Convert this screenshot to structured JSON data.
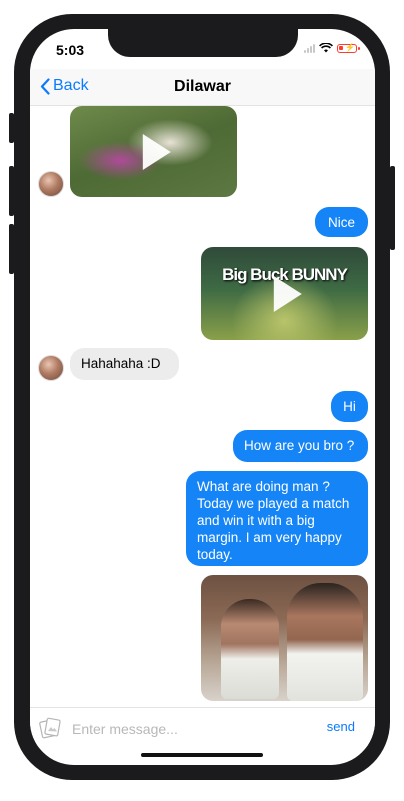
{
  "status_bar": {
    "time": "5:03"
  },
  "nav": {
    "back_label": "Back",
    "title": "Dilawar"
  },
  "messages": {
    "m1": {
      "type": "video",
      "direction": "incoming"
    },
    "m2": {
      "text": "Nice",
      "direction": "outgoing"
    },
    "m3": {
      "type": "video",
      "direction": "outgoing",
      "overlay_text": "Big Buck BUNNY"
    },
    "m4": {
      "text": "Hahahaha :D",
      "direction": "incoming"
    },
    "m5": {
      "text": "Hi",
      "direction": "outgoing"
    },
    "m6": {
      "text": "How are you bro ?",
      "direction": "outgoing"
    },
    "m7": {
      "text": "What are doing man ? Today we played a match and win it with a big margin. I am very happy today.",
      "direction": "outgoing"
    },
    "m8": {
      "type": "photo",
      "direction": "outgoing"
    }
  },
  "composer": {
    "placeholder": "Enter message...",
    "send_label": "send"
  },
  "colors": {
    "accent": "#0a7bff",
    "outgoing_bubble": "#1584f6",
    "incoming_bubble": "#ececec"
  }
}
